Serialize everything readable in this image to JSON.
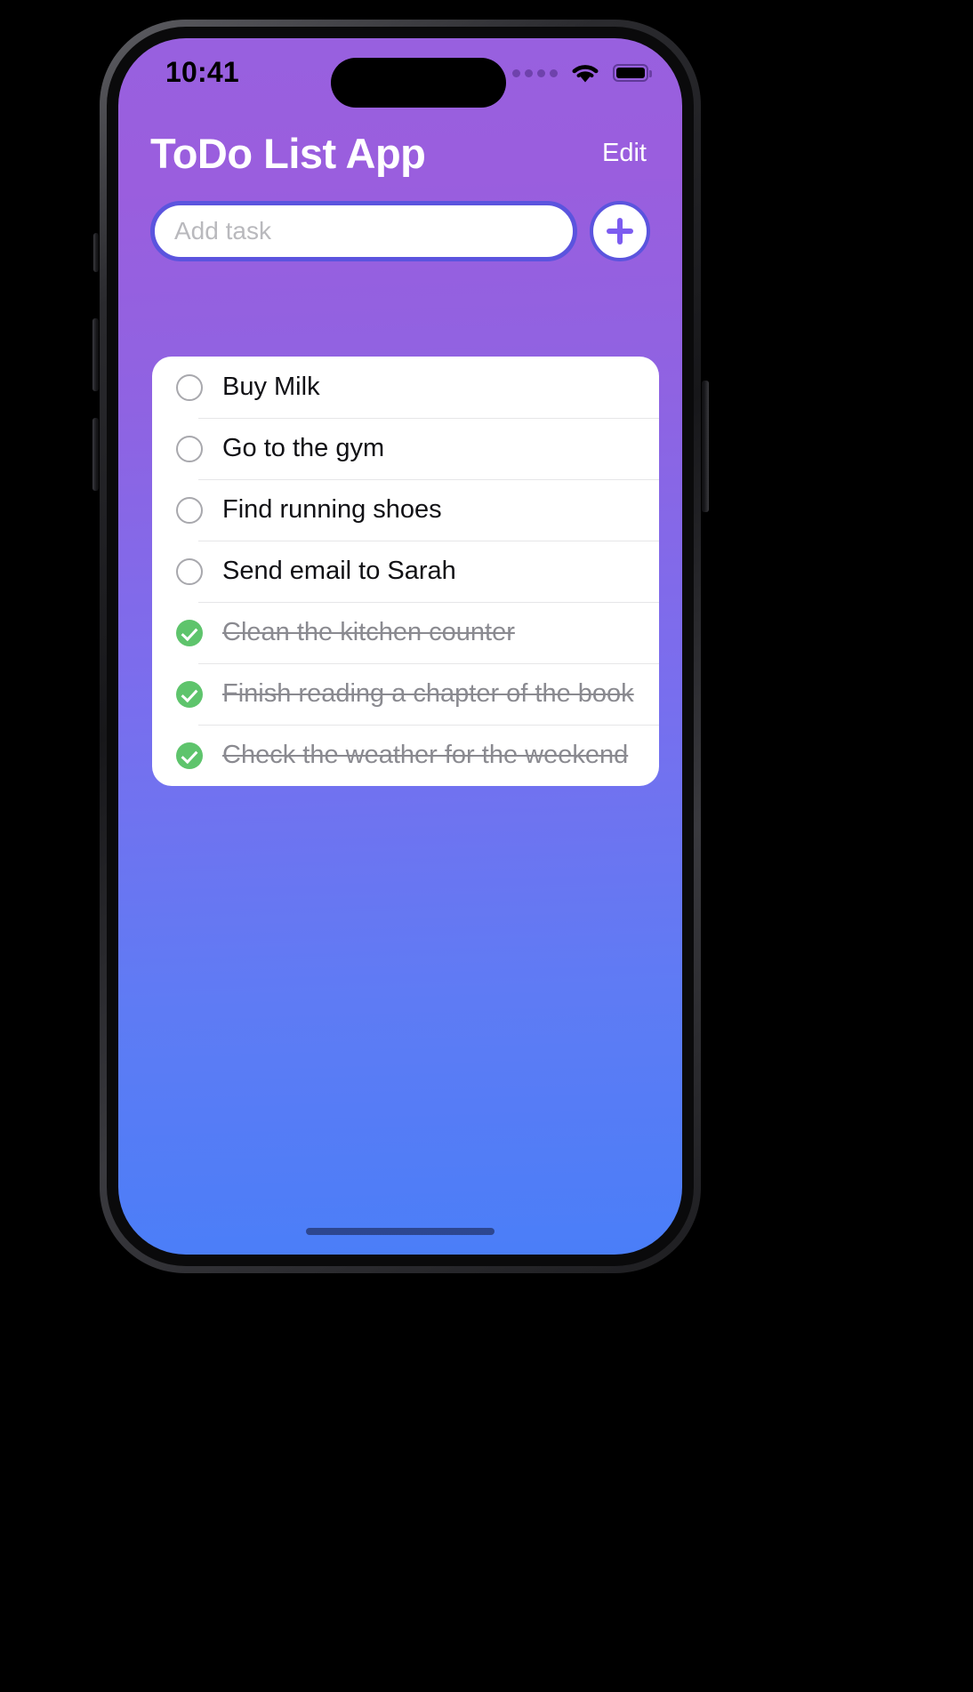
{
  "device": {
    "name": "iphone-mockup",
    "frame_color": "#1d1d20"
  },
  "status_bar": {
    "time": "10:41",
    "cellular_icon": "cellular-dots-icon",
    "cellular_dots": 4,
    "wifi_icon": "wifi-icon",
    "battery_icon": "battery-icon",
    "battery_level_percent": 100
  },
  "header": {
    "title": "ToDo List App",
    "edit_label": "Edit"
  },
  "add_task": {
    "placeholder": "Add task",
    "value": "",
    "add_button_icon": "plus-icon"
  },
  "colors": {
    "gradient_top": "#9860df",
    "gradient_bottom": "#4a7ef8",
    "accent_border": "#5b54de",
    "plus_accent": "#7c5cf0",
    "done_check": "#5ec46c",
    "pending_ring": "#a8a8ad",
    "completed_text": "#8a8a90",
    "card_background": "#ffffff"
  },
  "tasks": [
    {
      "label": "Buy Milk",
      "completed": false
    },
    {
      "label": "Go to the gym",
      "completed": false
    },
    {
      "label": "Find running shoes",
      "completed": false
    },
    {
      "label": "Send email to Sarah",
      "completed": false
    },
    {
      "label": "Clean the kitchen counter",
      "completed": true
    },
    {
      "label": "Finish reading a chapter of the book",
      "completed": true
    },
    {
      "label": "Check the weather for the weekend",
      "completed": true
    }
  ],
  "home_indicator": "home-indicator"
}
